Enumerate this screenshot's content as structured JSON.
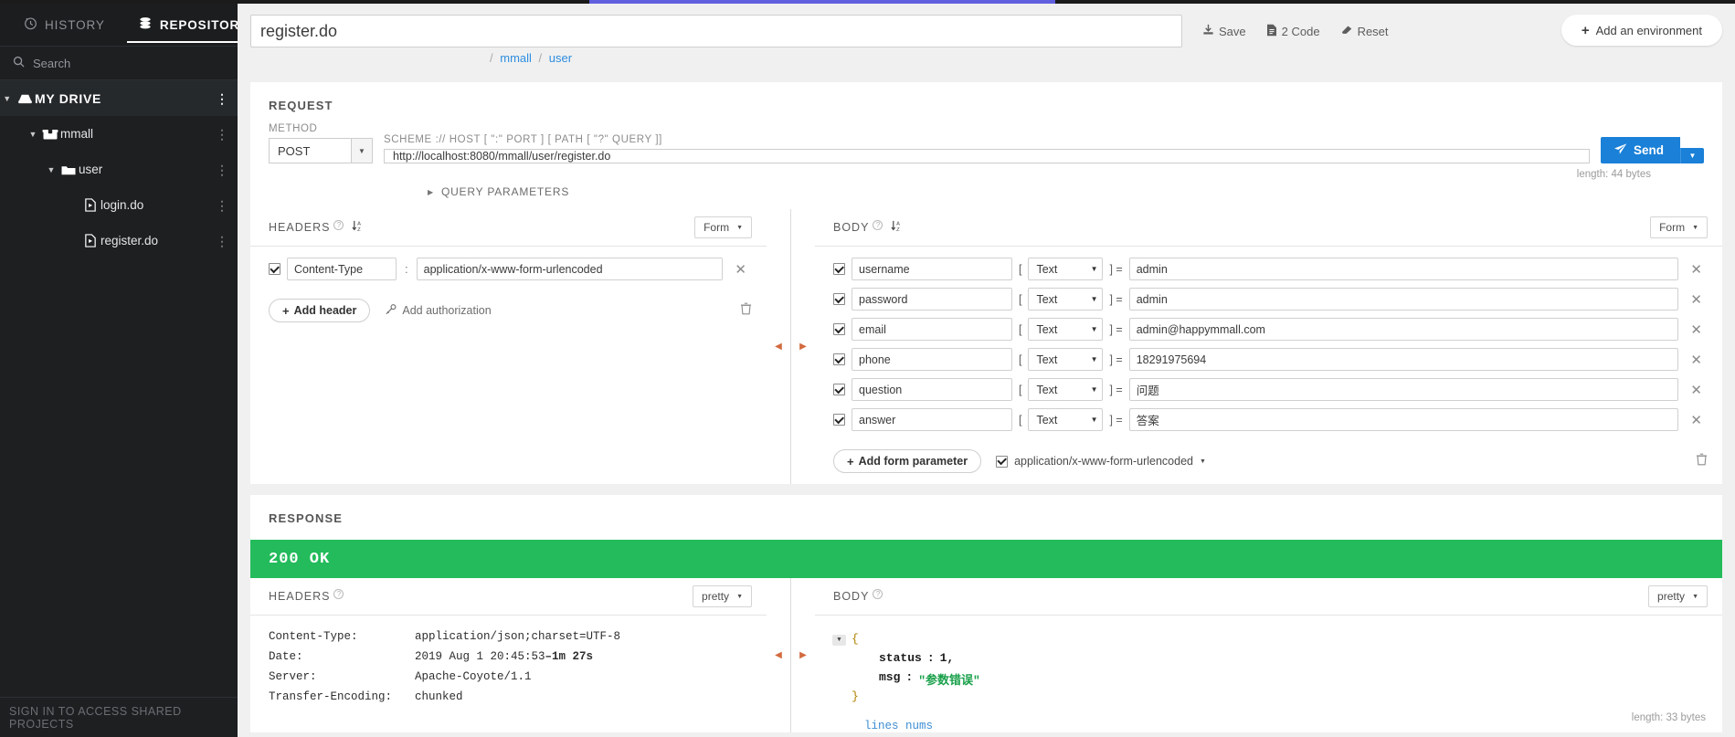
{
  "sidebar": {
    "tabs": [
      {
        "label": "HISTORY",
        "icon": "clock-icon",
        "active": false
      },
      {
        "label": "REPOSITORY",
        "icon": "database-icon",
        "active": true
      }
    ],
    "search_placeholder": "Search",
    "tree": [
      {
        "label": "MY DRIVE",
        "icon": "drive-icon",
        "depth": 0,
        "expanded": true,
        "type": "drive"
      },
      {
        "label": "mmall",
        "icon": "project-icon",
        "depth": 1,
        "expanded": true,
        "type": "project"
      },
      {
        "label": "user",
        "icon": "folder-icon",
        "depth": 2,
        "expanded": true,
        "type": "folder"
      },
      {
        "label": "login.do",
        "icon": "request-file-icon",
        "depth": 3,
        "expanded": false,
        "type": "request"
      },
      {
        "label": "register.do",
        "icon": "request-file-icon",
        "depth": 3,
        "expanded": false,
        "type": "request"
      }
    ],
    "signin_text": "SIGN IN TO ACCESS SHARED PROJECTS"
  },
  "topbar": {
    "request_name": "register.do",
    "buttons": [
      {
        "label": "Save",
        "icon": "save-icon"
      },
      {
        "label": "2 Code",
        "icon": "code-file-icon"
      },
      {
        "label": "Reset",
        "icon": "eraser-icon"
      }
    ],
    "environment_button": {
      "label": "Add an environment",
      "icon": "plus-icon"
    }
  },
  "breadcrumb": {
    "root": "/",
    "items": [
      "mmall",
      "user"
    ],
    "separator": "/"
  },
  "request": {
    "section_title": "REQUEST",
    "method_label": "METHOD",
    "method_value": "POST",
    "url_label": "SCHEME :// HOST [ \":\" PORT ] [ PATH [ \"?\" QUERY ]]",
    "url_value": "http://localhost:8080/mmall/user/register.do",
    "send_label": "Send",
    "length_label": "length: 44 bytes",
    "query_parameters_label": "QUERY PARAMETERS",
    "headers": {
      "title": "HEADERS",
      "view_mode": "Form",
      "rows": [
        {
          "enabled": true,
          "key": "Content-Type",
          "value": "application/x-www-form-urlencoded"
        }
      ],
      "add_label": "Add header",
      "auth_label": "Add authorization"
    },
    "body": {
      "title": "BODY",
      "view_mode": "Form",
      "rows": [
        {
          "enabled": true,
          "key": "username",
          "type": "Text",
          "value": "admin"
        },
        {
          "enabled": true,
          "key": "password",
          "type": "Text",
          "value": "admin"
        },
        {
          "enabled": true,
          "key": "email",
          "type": "Text",
          "value": "admin@happymmall.com"
        },
        {
          "enabled": true,
          "key": "phone",
          "type": "Text",
          "value": "18291975694"
        },
        {
          "enabled": true,
          "key": "question",
          "type": "Text",
          "value": "问题"
        },
        {
          "enabled": true,
          "key": "answer",
          "type": "Text",
          "value": "答案"
        }
      ],
      "add_label": "Add form parameter",
      "content_type": "application/x-www-form-urlencoded",
      "content_type_enabled": true
    }
  },
  "response": {
    "section_title": "RESPONSE",
    "status": "200 OK",
    "status_color": "#23bb5b",
    "headers": {
      "title": "HEADERS",
      "view_mode": "pretty",
      "rows": [
        {
          "key": "Content-Type:",
          "value": "application/json;charset=UTF-8",
          "ago": ""
        },
        {
          "key": "Date:",
          "value": "2019 Aug 1 20:45:53 ",
          "ago": "–1m 27s"
        },
        {
          "key": "Server:",
          "value": "Apache-Coyote/1.1",
          "ago": ""
        },
        {
          "key": "Transfer-Encoding:",
          "value": "chunked",
          "ago": ""
        }
      ]
    },
    "body": {
      "title": "BODY",
      "view_mode": "pretty",
      "open_brace": "{",
      "close_brace": "}",
      "fields": [
        {
          "key": "status",
          "sep": ":",
          "value": "1,",
          "kind": "number"
        },
        {
          "key": "msg",
          "sep": ":",
          "value": "\"参数错误\"",
          "kind": "string"
        }
      ],
      "lines_nums_label": "lines nums",
      "length_label": "length: 33 bytes"
    }
  }
}
